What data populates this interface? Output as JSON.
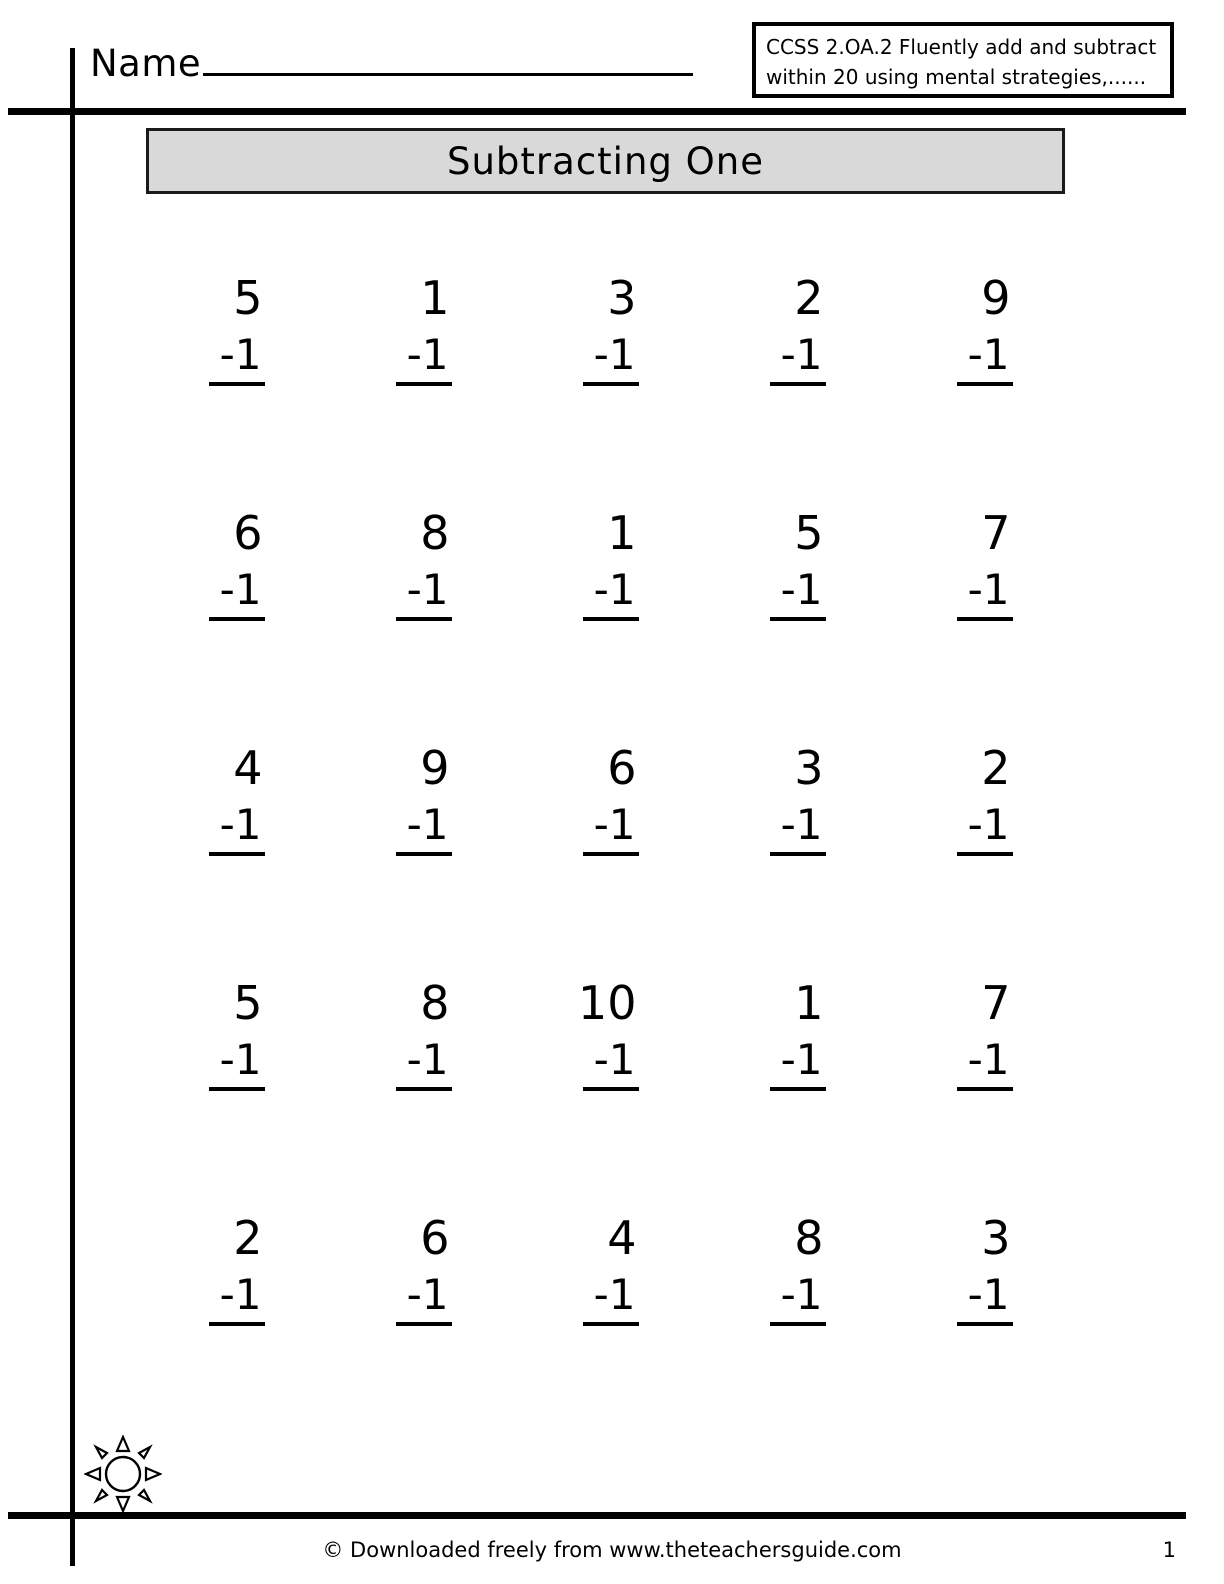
{
  "header": {
    "name_label": "Name",
    "name_value": "",
    "name_placeholder": "",
    "ccss_line1": "CCSS 2.OA.2  Fluently add and subtract",
    "ccss_line2": "within 20 using mental strategies,......"
  },
  "title": {
    "text": "Subtracting  One",
    "background_color": "#d9d9d9",
    "border_color": "#1a1a1a"
  },
  "worksheet": {
    "operator": "-1",
    "rows": [
      {
        "cells": [
          {
            "minuend": "5",
            "subtrahend": "-1"
          },
          {
            "minuend": "1",
            "subtrahend": "-1"
          },
          {
            "minuend": "3",
            "subtrahend": "-1"
          },
          {
            "minuend": "2",
            "subtrahend": "-1"
          },
          {
            "minuend": "9",
            "subtrahend": "-1"
          }
        ]
      },
      {
        "cells": [
          {
            "minuend": "6",
            "subtrahend": "-1"
          },
          {
            "minuend": "8",
            "subtrahend": "-1"
          },
          {
            "minuend": "1",
            "subtrahend": "-1"
          },
          {
            "minuend": "5",
            "subtrahend": "-1"
          },
          {
            "minuend": "7",
            "subtrahend": "-1"
          }
        ]
      },
      {
        "cells": [
          {
            "minuend": "4",
            "subtrahend": "-1"
          },
          {
            "minuend": "9",
            "subtrahend": "-1"
          },
          {
            "minuend": "6",
            "subtrahend": "-1"
          },
          {
            "minuend": "3",
            "subtrahend": "-1"
          },
          {
            "minuend": "2",
            "subtrahend": "-1"
          }
        ]
      },
      {
        "cells": [
          {
            "minuend": "5",
            "subtrahend": "-1"
          },
          {
            "minuend": "8",
            "subtrahend": "-1"
          },
          {
            "minuend": "10",
            "subtrahend": "-1"
          },
          {
            "minuend": "1",
            "subtrahend": "-1"
          },
          {
            "minuend": "7",
            "subtrahend": "-1"
          }
        ]
      },
      {
        "cells": [
          {
            "minuend": "2",
            "subtrahend": "-1"
          },
          {
            "minuend": "6",
            "subtrahend": "-1"
          },
          {
            "minuend": "4",
            "subtrahend": "-1"
          },
          {
            "minuend": "8",
            "subtrahend": "-1"
          },
          {
            "minuend": "3",
            "subtrahend": "-1"
          }
        ]
      }
    ]
  },
  "decoration": {
    "sun_icon_name": "sun-icon"
  },
  "footer": {
    "credit": "© Downloaded freely from www.theteachersguide.com",
    "page_number": "1"
  }
}
